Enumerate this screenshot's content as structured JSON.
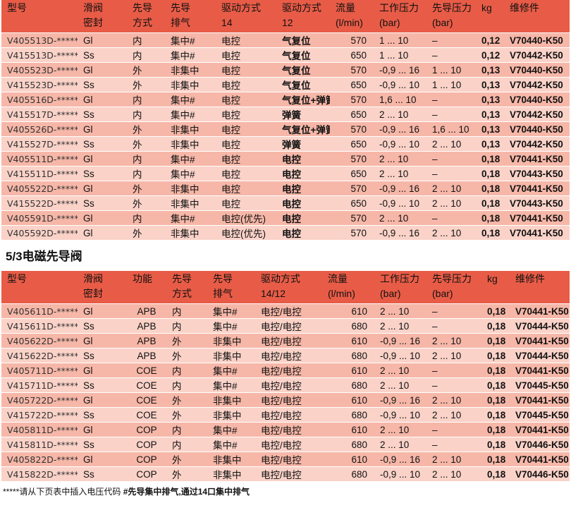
{
  "table1": {
    "headers": [
      [
        "型号",
        ""
      ],
      [
        "滑阀",
        "密封"
      ],
      [
        "先导",
        "方式"
      ],
      [
        "先导",
        "排气"
      ],
      [
        "驱动方式",
        "14"
      ],
      [
        "驱动方式",
        "12"
      ],
      [
        "流量",
        "(l/min)"
      ],
      [
        "工作压力",
        "(bar)"
      ],
      [
        "先导压力",
        "(bar)"
      ],
      [
        "kg",
        ""
      ],
      [
        "维修件",
        ""
      ]
    ],
    "rows": [
      [
        "V405513D-*****",
        "Gl",
        "内",
        "集中#",
        "电控",
        "气复位",
        "570",
        "1 ... 10",
        "–",
        "0,12",
        "V70440-K50"
      ],
      [
        "V415513D-*****",
        "Ss",
        "内",
        "集中#",
        "电控",
        "气复位",
        "650",
        "1 ... 10",
        "–",
        "0,12",
        "V70442-K50"
      ],
      [
        "V405523D-*****",
        "Gl",
        "外",
        "非集中",
        "电控",
        "气复位",
        "570",
        "-0,9 ... 16",
        "1 ... 10",
        "0,13",
        "V70440-K50"
      ],
      [
        "V415523D-*****",
        "Ss",
        "外",
        "非集中",
        "电控",
        "气复位",
        "650",
        "-0,9 ... 10",
        "1 ... 10",
        "0,13",
        "V70442-K50"
      ],
      [
        "V405516D-*****",
        "Gl",
        "内",
        "集中#",
        "电控",
        "气复位+弹簧",
        "570",
        "1,6 ... 10",
        "–",
        "0,13",
        "V70440-K50"
      ],
      [
        "V415517D-*****",
        "Ss",
        "内",
        "集中#",
        "电控",
        "弹簧",
        "650",
        "2 ... 10",
        "–",
        "0,13",
        "V70442-K50"
      ],
      [
        "V405526D-*****",
        "Gl",
        "外",
        "非集中",
        "电控",
        "气复位+弹簧",
        "570",
        "-0,9 ... 16",
        "1,6 ... 10",
        "0,13",
        "V70440-K50"
      ],
      [
        "V415527D-*****",
        "Ss",
        "外",
        "非集中",
        "电控",
        "弹簧",
        "650",
        "-0,9 ... 10",
        "2 ... 10",
        "0,13",
        "V70442-K50"
      ],
      [
        "V405511D-*****",
        "Gl",
        "内",
        "集中#",
        "电控",
        "电控",
        "570",
        "2 ... 10",
        "–",
        "0,18",
        "V70441-K50"
      ],
      [
        "V415511D-*****",
        "Ss",
        "内",
        "集中#",
        "电控",
        "电控",
        "650",
        "2 ... 10",
        "–",
        "0,18",
        "V70443-K50"
      ],
      [
        "V405522D-*****",
        "Gl",
        "外",
        "非集中",
        "电控",
        "电控",
        "570",
        "-0,9 ... 16",
        "2 ... 10",
        "0,18",
        "V70441-K50"
      ],
      [
        "V415522D-*****",
        "Ss",
        "外",
        "非集中",
        "电控",
        "电控",
        "650",
        "-0,9 ... 10",
        "2 ... 10",
        "0,18",
        "V70443-K50"
      ],
      [
        "V405591D-*****",
        "Gl",
        "内",
        "集中#",
        "电控(优先)",
        "电控",
        "570",
        "2 ... 10",
        "–",
        "0,18",
        "V70441-K50"
      ],
      [
        "V405592D-*****",
        "Gl",
        "外",
        "非集中",
        "电控(优先)",
        "电控",
        "570",
        "-0,9 ... 16",
        "2 ... 10",
        "0,18",
        "V70441-K50"
      ]
    ]
  },
  "section2_title": "5/3电磁先导阀",
  "table2": {
    "headers": [
      [
        "型号",
        ""
      ],
      [
        "滑阀",
        "密封"
      ],
      [
        "功能",
        ""
      ],
      [
        "先导",
        "方式"
      ],
      [
        "先导",
        "排气"
      ],
      [
        "驱动方式",
        "14/12"
      ],
      [
        "流量",
        "(l/min)"
      ],
      [
        "工作压力",
        "(bar)"
      ],
      [
        "先导压力",
        "(bar)"
      ],
      [
        "kg",
        ""
      ],
      [
        "维修件",
        ""
      ]
    ],
    "rows": [
      [
        "V405611D-*****",
        "Gl",
        "APB",
        "内",
        "集中#",
        "电控/电控",
        "610",
        "2 ... 10",
        "–",
        "0,18",
        "V70441-K50"
      ],
      [
        "V415611D-*****",
        "Ss",
        "APB",
        "内",
        "集中#",
        "电控/电控",
        "680",
        "2 ... 10",
        "–",
        "0,18",
        "V70444-K50"
      ],
      [
        "V405622D-*****",
        "Gl",
        "APB",
        "外",
        "非集中",
        "电控/电控",
        "610",
        "-0,9 ... 16",
        "2 ... 10",
        "0,18",
        "V70441-K50"
      ],
      [
        "V415622D-*****",
        "Ss",
        "APB",
        "外",
        "非集中",
        "电控/电控",
        "680",
        "-0,9 ... 10",
        "2 ... 10",
        "0,18",
        "V70444-K50"
      ],
      [
        "V405711D-*****",
        "Gl",
        "COE",
        "内",
        "集中#",
        "电控/电控",
        "610",
        "2 ... 10",
        "–",
        "0,18",
        "V70441-K50"
      ],
      [
        "V415711D-*****",
        "Ss",
        "COE",
        "内",
        "集中#",
        "电控/电控",
        "680",
        "2 ... 10",
        "–",
        "0,18",
        "V70445-K50"
      ],
      [
        "V405722D-*****",
        "Gl",
        "COE",
        "外",
        "非集中",
        "电控/电控",
        "610",
        "-0,9 ... 16",
        "2 ... 10",
        "0,18",
        "V70441-K50"
      ],
      [
        "V415722D-*****",
        "Ss",
        "COE",
        "外",
        "非集中",
        "电控/电控",
        "680",
        "-0,9 ... 10",
        "2 ... 10",
        "0,18",
        "V70445-K50"
      ],
      [
        "V405811D-*****",
        "Gl",
        "COP",
        "内",
        "集中#",
        "电控/电控",
        "610",
        "2 ... 10",
        "–",
        "0,18",
        "V70441-K50"
      ],
      [
        "V415811D-*****",
        "Ss",
        "COP",
        "内",
        "集中#",
        "电控/电控",
        "680",
        "2 ... 10",
        "–",
        "0,18",
        "V70446-K50"
      ],
      [
        "V405822D-*****",
        "Gl",
        "COP",
        "外",
        "非集中",
        "电控/电控",
        "610",
        "-0,9 ... 16",
        "2 ... 10",
        "0,18",
        "V70441-K50"
      ],
      [
        "V415822D-*****",
        "Ss",
        "COP",
        "外",
        "非集中",
        "电控/电控",
        "680",
        "-0,9 ... 10",
        "2 ... 10",
        "0,18",
        "V70446-K50"
      ]
    ]
  },
  "footnote": {
    "part1": "*****请从下页表中插入电压代码 ",
    "part2": "#先导集中排气,通过14口集中排气"
  }
}
